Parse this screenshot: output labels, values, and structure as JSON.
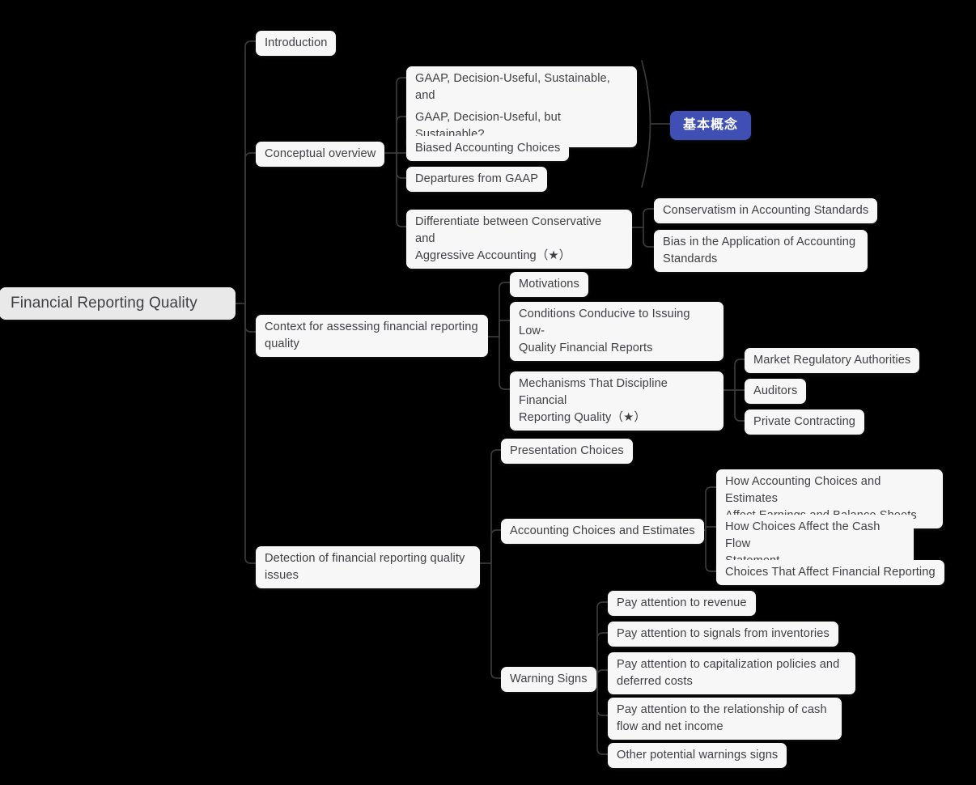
{
  "diagram": {
    "type": "mind-map",
    "background_color": "#000000",
    "node_color": "#f7f7f7",
    "root_color": "#e9e9e9",
    "badge_color": "#3f4fb3",
    "text_color": "#3f4044",
    "edge_color": "#3a3a3a"
  },
  "root": {
    "label": "Financial Reporting Quality"
  },
  "branches": {
    "introduction": {
      "label": "Introduction"
    },
    "conceptual_overview": {
      "label": "Conceptual overview",
      "children": {
        "gaap_sustainable_adequate": "GAAP, Decision-Useful, Sustainable, and\nAdequate Returns",
        "gaap_but_sustainable": "GAAP, Decision-Useful, but Sustainable?",
        "biased_accounting_choices": "Biased Accounting Choices",
        "departures_from_gaap": "Departures from GAAP",
        "differentiate": "Differentiate between Conservative and\nAggressive Accounting（★）"
      },
      "group_badge": "基本概念",
      "differentiate_children": {
        "conservatism": "Conservatism in Accounting Standards",
        "bias_application": "Bias in the Application of Accounting\nStandards"
      }
    },
    "context": {
      "label": "Context for assessing financial reporting\nquality",
      "children": {
        "motivations": "Motivations",
        "conditions": "Conditions Conducive to Issuing Low-\nQuality Financial Reports",
        "mechanisms": "Mechanisms That Discipline Financial\nReporting Quality（★）"
      },
      "mechanisms_children": {
        "market_regulatory": "Market Regulatory Authorities",
        "auditors": "Auditors",
        "private_contracting": "Private Contracting"
      }
    },
    "detection": {
      "label": "Detection of financial reporting quality\nissues",
      "children": {
        "presentation_choices": "Presentation Choices",
        "accounting_choices": "Accounting Choices and Estimates",
        "warning_signs": "Warning Signs"
      },
      "accounting_choices_children": {
        "affect_earnings": "How Accounting Choices and Estimates\nAffect Earnings and Balance Sheets",
        "affect_cash_flow": "How Choices Affect the Cash Flow\nStatement",
        "affect_reporting": "Choices That Affect Financial Reporting"
      },
      "warning_signs_children": {
        "revenue": "Pay attention to revenue",
        "inventories": "Pay attention to signals from inventories",
        "capitalization": " Pay attention to capitalization policies and\ndeferred costs",
        "cash_flow_net_income": " Pay attention to the relationship of cash\nflow and net income",
        "other": "Other potential warnings signs"
      }
    }
  }
}
